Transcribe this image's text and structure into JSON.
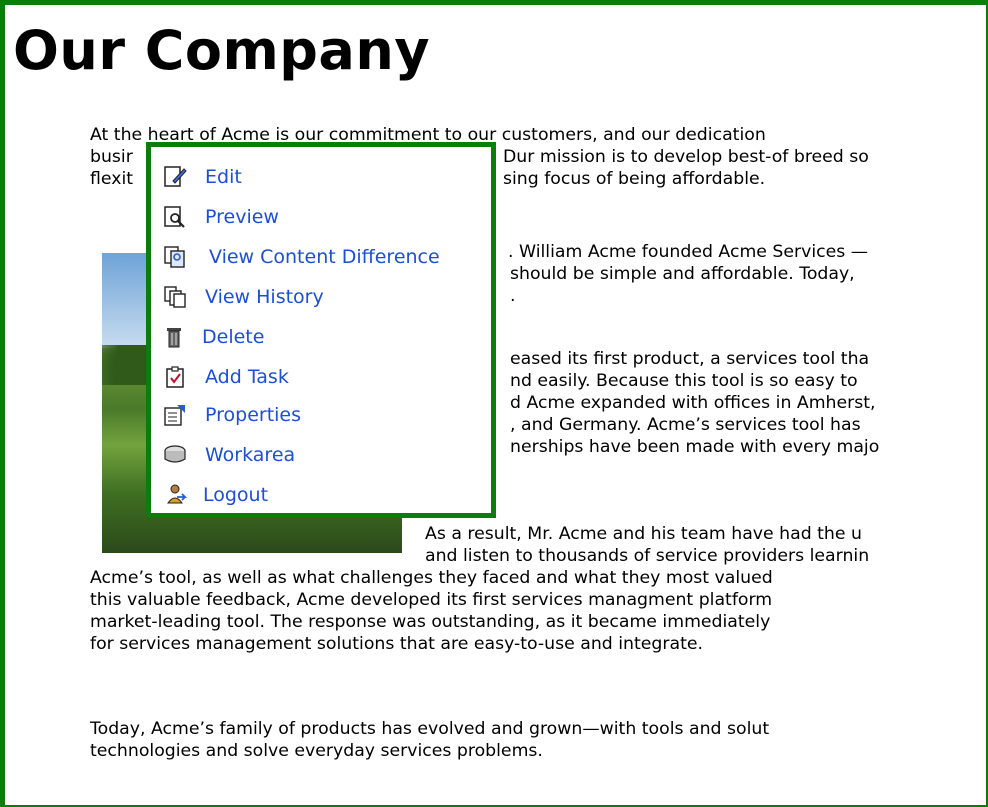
{
  "page": {
    "title": "Our Company",
    "lines": [
      "At the heart of Acme is our commitment to our customers, and our dedication",
      "busir",
      "Dur mission is to develop best-of breed so",
      "flexit",
      "sing focus of being affordable.",
      ". William Acme founded Acme Services —",
      "should be simple and affordable.  Today,",
      ".",
      "eased its first product, a services tool tha",
      "nd easily.  Because this tool is so easy to",
      "d Acme expanded with offices in Amherst,",
      ", and Germany. Acme’s services tool has",
      "nerships have been made with every majo",
      "As a result, Mr. Acme and his team have had the u",
      "and listen to thousands of service providers learnin",
      "Acme’s tool, as well as what challenges they faced and what they most valued",
      "this valuable feedback, Acme developed its first services managment platform",
      "market-leading tool. The response was outstanding, as it became immediately",
      "for services management solutions that are easy-to-use and integrate.",
      "Today, Acme’s family of products has evolved and grown—with tools and solut",
      "technologies and solve everyday services problems."
    ]
  },
  "menu": {
    "items": [
      {
        "label": "Edit",
        "icon": "edit-icon"
      },
      {
        "label": "Preview",
        "icon": "preview-icon"
      },
      {
        "label": "View Content Difference",
        "icon": "content-difference-icon"
      },
      {
        "label": "View History",
        "icon": "history-icon"
      },
      {
        "label": "Delete",
        "icon": "trash-icon"
      },
      {
        "label": "Add Task",
        "icon": "task-icon"
      },
      {
        "label": "Properties",
        "icon": "properties-icon"
      },
      {
        "label": "Workarea",
        "icon": "workarea-icon"
      },
      {
        "label": "Logout",
        "icon": "logout-icon"
      }
    ]
  },
  "colors": {
    "border": "#0a7d0a",
    "link": "#1a4fd6"
  }
}
